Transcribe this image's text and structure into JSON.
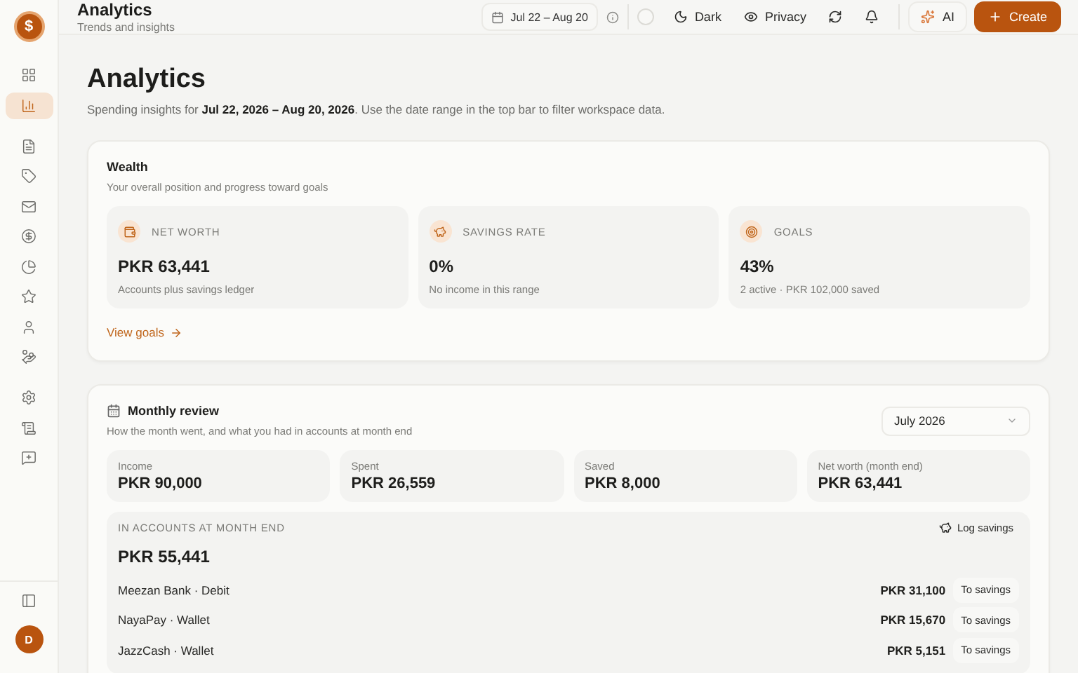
{
  "topbar": {
    "title": "Analytics",
    "subtitle": "Trends and insights",
    "date_range": "Jul 22 – Aug 20",
    "dark_label": "Dark",
    "privacy_label": "Privacy",
    "ai_label": "AI",
    "create_label": "Create"
  },
  "sidebar": {
    "logo": "$",
    "items": [
      {
        "selected": false
      },
      {
        "selected": true
      },
      {
        "selected": false
      },
      {
        "selected": false
      },
      {
        "selected": false
      },
      {
        "selected": false
      },
      {
        "selected": false
      },
      {
        "selected": false
      },
      {
        "selected": false
      },
      {
        "selected": false
      },
      {
        "selected": false
      },
      {
        "selected": false
      },
      {
        "selected": false
      }
    ],
    "avatar": "D"
  },
  "page": {
    "title": "Analytics",
    "intro": "Spending insights for **Jul 22, 2026 – Aug 20, 2026**. Use the date range in the top bar to filter workspace data."
  },
  "wealth": {
    "title": "Wealth",
    "subtitle": "Your overall position and progress toward goals",
    "stats": [
      {
        "kind": "wallet",
        "label": "NET WORTH",
        "value": "PKR 63,441",
        "note": "Accounts plus savings ledger"
      },
      {
        "kind": "piggy",
        "label": "SAVINGS RATE",
        "value": "0%",
        "note": "No income in this range"
      },
      {
        "kind": "target",
        "label": "GOALS",
        "value": "43%",
        "note": "2 active · PKR 102,000 saved"
      }
    ],
    "link": "View goals"
  },
  "monthly": {
    "title": "Monthly review",
    "subtitle": "How the month went, and what you had in accounts at month end",
    "month": "July 2026",
    "stats": [
      {
        "label": "Income",
        "value": "PKR 90,000"
      },
      {
        "label": "Spent",
        "value": "PKR 26,559"
      },
      {
        "label": "Saved",
        "value": "PKR 8,000"
      },
      {
        "label": "Net worth (month end)",
        "value": "PKR 63,441"
      }
    ],
    "accounts": {
      "title": "IN ACCOUNTS AT MONTH END",
      "log_label": "Log savings",
      "total": "PKR 55,441",
      "rows": [
        {
          "name": "Meezan Bank · Debit",
          "amount": "PKR 31,100",
          "action": "To savings"
        },
        {
          "name": "NayaPay · Wallet",
          "amount": "PKR 15,670",
          "action": "To savings"
        },
        {
          "name": "JazzCash · Wallet",
          "amount": "PKR 5,151",
          "action": "To savings"
        }
      ]
    }
  }
}
